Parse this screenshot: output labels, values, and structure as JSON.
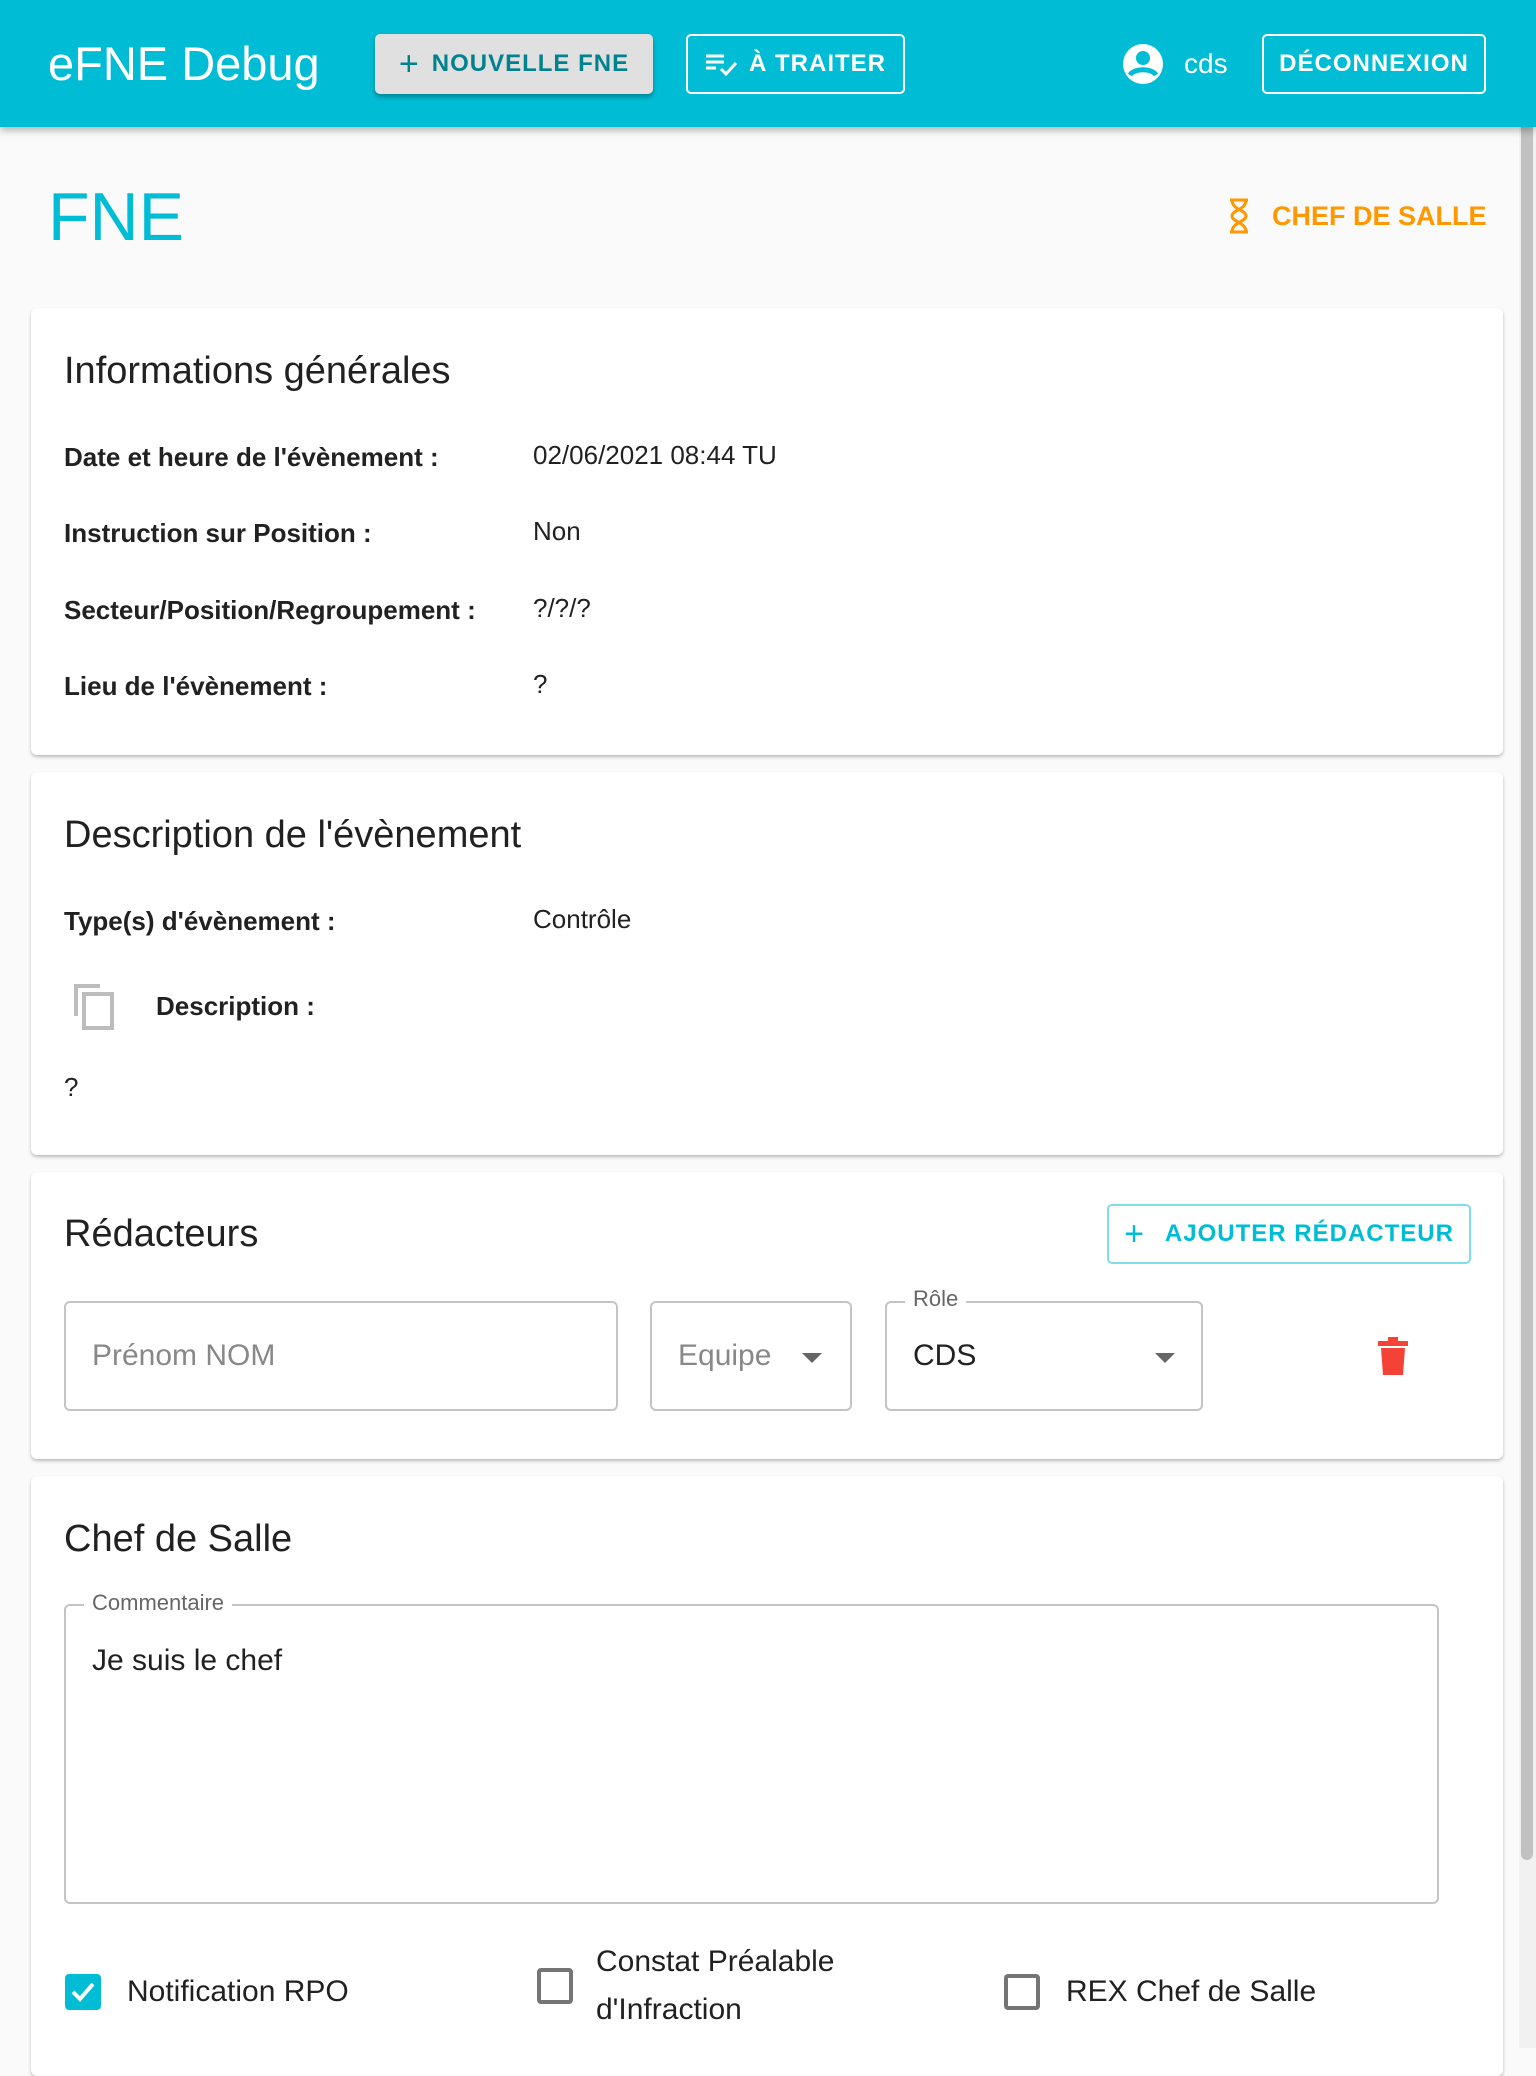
{
  "header": {
    "title": "eFNE Debug",
    "new_fne": "Nouvelle FNE",
    "to_process": "À traiter",
    "user": "cds",
    "logout": "Déconnexion"
  },
  "page": {
    "title": "FNE",
    "status": "Chef de salle"
  },
  "general": {
    "heading": "Informations générales",
    "rows": [
      {
        "label": "Date et heure de l'évènement :",
        "value": "02/06/2021 08:44 TU"
      },
      {
        "label": "Instruction sur Position :",
        "value": "Non"
      },
      {
        "label": "Secteur/Position/Regroupement :",
        "value": "?/?/?"
      },
      {
        "label": "Lieu de l'évènement :",
        "value": "?"
      }
    ]
  },
  "description": {
    "heading": "Description de l'évènement",
    "type_label": "Type(s) d'évènement :",
    "type_value": "Contrôle",
    "desc_label": "Description :",
    "desc_value": "?"
  },
  "writers": {
    "heading": "Rédacteurs",
    "add": "Ajouter rédacteur",
    "name_placeholder": "Prénom NOM",
    "team_placeholder": "Equipe",
    "role_label": "Rôle",
    "role_value": "CDS"
  },
  "chief": {
    "heading": "Chef de Salle",
    "comment_label": "Commentaire",
    "comment_value": "Je suis le chef",
    "checkboxes": [
      {
        "label": "Notification RPO",
        "checked": true
      },
      {
        "label": "Constat Préalable d'Infraction",
        "checked": false
      },
      {
        "label": "REX Chef de Salle",
        "checked": false
      }
    ]
  },
  "colors": {
    "primary": "#00bcd4",
    "warning": "#ff9800",
    "danger": "#f44336"
  }
}
